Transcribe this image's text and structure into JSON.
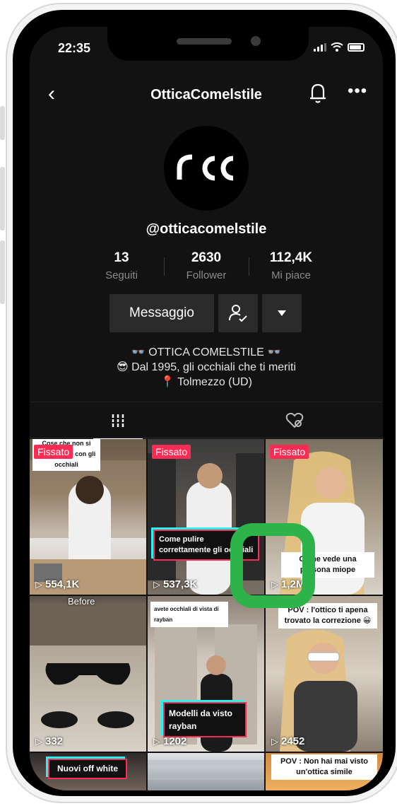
{
  "status": {
    "time": "22:35"
  },
  "header": {
    "title": "OtticaComelstile"
  },
  "profile": {
    "username": "@otticacomelstile",
    "stats": [
      {
        "value": "13",
        "label": "Seguiti"
      },
      {
        "value": "2630",
        "label": "Follower"
      },
      {
        "value": "112,4K",
        "label": "Mi piace"
      }
    ],
    "message_label": "Messaggio",
    "bio": {
      "line1": "👓 OTTICA COMELSTILE 👓",
      "line2": "😎 Dal 1995, gli occhiali che ti meriti",
      "line3": "📍 Tolmezzo (UD)"
    }
  },
  "videos": [
    {
      "pinned": "Fissato",
      "views": "554,1K",
      "top_text": "Cose che non si devono fare con gli occhiali"
    },
    {
      "pinned": "Fissato",
      "views": "537,3K",
      "caption": "Come pulire correttamente gli occhiali"
    },
    {
      "pinned": "Fissato",
      "views": "1,2M",
      "caption": "Come vede una persona miope"
    },
    {
      "views": "332",
      "top_text": "Before"
    },
    {
      "views": "1202",
      "top_text": "avete occhiali di vista di rayban",
      "caption": "Modelli da visto rayban"
    },
    {
      "views": "2452",
      "caption": "POV : l'ottico ti apena trovato la correzione 😀"
    },
    {
      "caption": "Nuovi off white"
    },
    {},
    {
      "caption": "POV : Non hai mai visto un'ottica simile"
    }
  ],
  "colors": {
    "accent_red": "#fe2c55",
    "accent_cyan": "#25f4ee",
    "overlay_green": "#2db34a"
  }
}
